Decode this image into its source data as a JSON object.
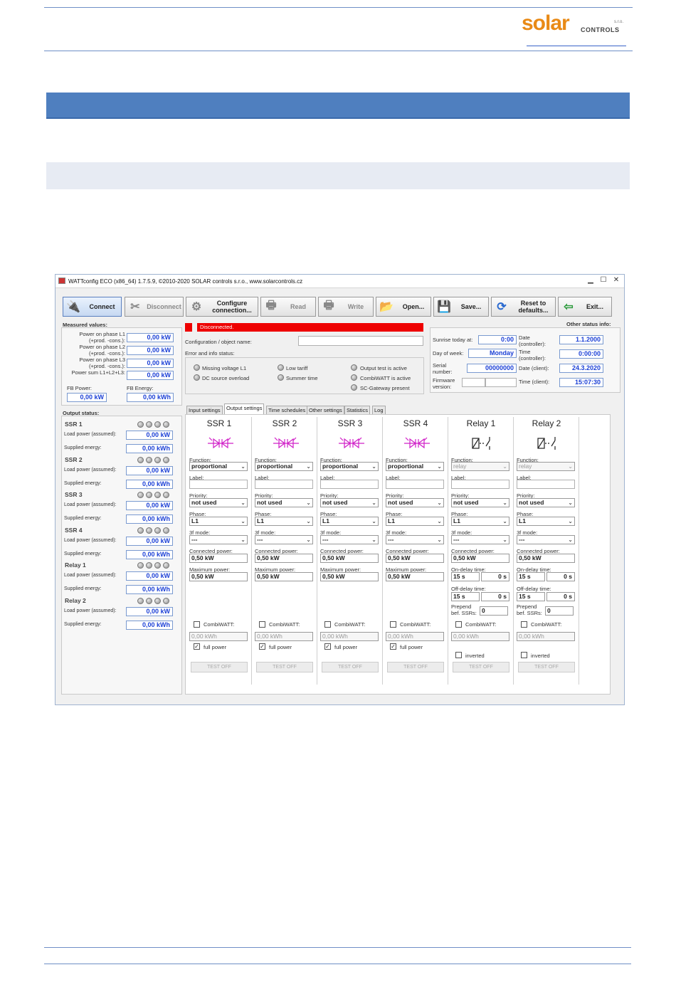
{
  "logo": {
    "text": "solar",
    "subtext": "CONTROLS",
    "sro": "s.r.o."
  },
  "window": {
    "title": "WATTconfig ECO (x86_64) 1.7.5.9, ©2010-2020 SOLAR controls s.r.o., www.solarcontrols.cz",
    "min": "▁",
    "max": "☐",
    "close": "✕"
  },
  "toolbar": {
    "connect": "Connect",
    "disconnect": "Disconnect",
    "configure": "Configure connection...",
    "read": "Read",
    "write": "Write",
    "open": "Open...",
    "save": "Save...",
    "reset": "Reset to defaults...",
    "exit": "Exit..."
  },
  "measured": {
    "title": "Measured values:",
    "rows": [
      {
        "label": "Power on phase L1 (+prod. -cons.):",
        "value": "0,00 kW"
      },
      {
        "label": "Power on phase L2 (+prod. -cons.):",
        "value": "0,00 kW"
      },
      {
        "label": "Power on phase L3 (+prod. -cons.):",
        "value": "0,00 kW"
      },
      {
        "label": "Power sum L1+L2+L3:",
        "value": "0,00 kW"
      }
    ],
    "fb_power_label": "FB Power:",
    "fb_power": "0,00 kW",
    "fb_energy_label": "FB Energy:",
    "fb_energy": "0,00 kWh"
  },
  "status": {
    "text": "Disconnected.",
    "color": "#ee0000",
    "config_label": "Configuration / object name:",
    "config_value": "",
    "error_title": "Error and info status:",
    "flags": [
      "Missing voltage L1",
      "DC source overload",
      "Low tariff",
      "Summer time",
      "Output test is active",
      "CombiWATT is active",
      "SC-Gateway present"
    ]
  },
  "other": {
    "title": "Other status info:",
    "sunrise_label": "Sunrise today at:",
    "sunrise": "0:00",
    "dow_label": "Day of week:",
    "dow": "Monday",
    "serial_label": "Serial number:",
    "serial": "00000000",
    "fw_label": "Firmware version:",
    "fw": "",
    "date_ctrl_label": "Date (controller):",
    "date_ctrl": "1.1.2000",
    "time_ctrl_label": "Time (controller):",
    "time_ctrl": "0:00:00",
    "date_client_label": "Date (client):",
    "date_client": "24.3.2020",
    "time_client_label": "Time (client):",
    "time_client": "15:07:30"
  },
  "output_status": {
    "title": "Output status:",
    "load_label": "Load power (assumed):",
    "energy_label": "Supplied energy:",
    "items": [
      {
        "name": "SSR 1",
        "load": "0,00 kW",
        "energy": "0,00 kWh"
      },
      {
        "name": "SSR 2",
        "load": "0,00 kW",
        "energy": "0,00 kWh"
      },
      {
        "name": "SSR 3",
        "load": "0,00 kW",
        "energy": "0,00 kWh"
      },
      {
        "name": "SSR 4",
        "load": "0,00 kW",
        "energy": "0,00 kWh"
      },
      {
        "name": "Relay 1",
        "load": "0,00 kW",
        "energy": "0,00 kWh"
      },
      {
        "name": "Relay 2",
        "load": "0,00 kW",
        "energy": "0,00 kWh"
      }
    ]
  },
  "tabs": [
    "Input settings",
    "Output settings",
    "Time schedules",
    "Other settings",
    "Statistics",
    "Log"
  ],
  "labels": {
    "function": "Function:",
    "label": "Label:",
    "priority": "Priority:",
    "phase": "Phase:",
    "mode3f": "3f mode:",
    "connected": "Connected power:",
    "maximum": "Maximum power:",
    "ondelay": "On-delay time:",
    "offdelay": "Off-delay time:",
    "prepend": "Prepend bef. SSRs:",
    "combiwatt": "CombiWATT:",
    "fullpower": "full power",
    "inverted": "inverted",
    "test": "TEST OFF"
  },
  "channels": [
    {
      "name": "SSR 1",
      "function": "proportional",
      "priority": "not used",
      "phase": "L1",
      "mode3f": "---",
      "connected": "0,50 kW",
      "maximum": "0,50 kW",
      "combi": "0,00 kWh"
    },
    {
      "name": "SSR 2",
      "function": "proportional",
      "priority": "not used",
      "phase": "L1",
      "mode3f": "---",
      "connected": "0,50 kW",
      "maximum": "0,50 kW",
      "combi": "0,00 kWh"
    },
    {
      "name": "SSR 3",
      "function": "proportional",
      "priority": "not used",
      "phase": "L1",
      "mode3f": "---",
      "connected": "0,50 kW",
      "maximum": "0,50 kW",
      "combi": "0,00 kWh"
    },
    {
      "name": "SSR 4",
      "function": "proportional",
      "priority": "not used",
      "phase": "L1",
      "mode3f": "---",
      "connected": "0,50 kW",
      "maximum": "0,50 kW",
      "combi": "0,00 kWh"
    },
    {
      "name": "Relay 1",
      "function": "relay",
      "priority": "not used",
      "phase": "L1",
      "mode3f": "---",
      "connected": "0,50 kW",
      "ondelay": "15 s",
      "ondelay2": "0 s",
      "offdelay": "15 s",
      "offdelay2": "0 s",
      "prepend": "0",
      "combi": "0,00 kWh"
    },
    {
      "name": "Relay 2",
      "function": "relay",
      "priority": "not used",
      "phase": "L1",
      "mode3f": "---",
      "connected": "0,50 kW",
      "ondelay": "15 s",
      "ondelay2": "0 s",
      "offdelay": "15 s",
      "offdelay2": "0 s",
      "prepend": "0",
      "combi": "0,00 kWh"
    }
  ]
}
